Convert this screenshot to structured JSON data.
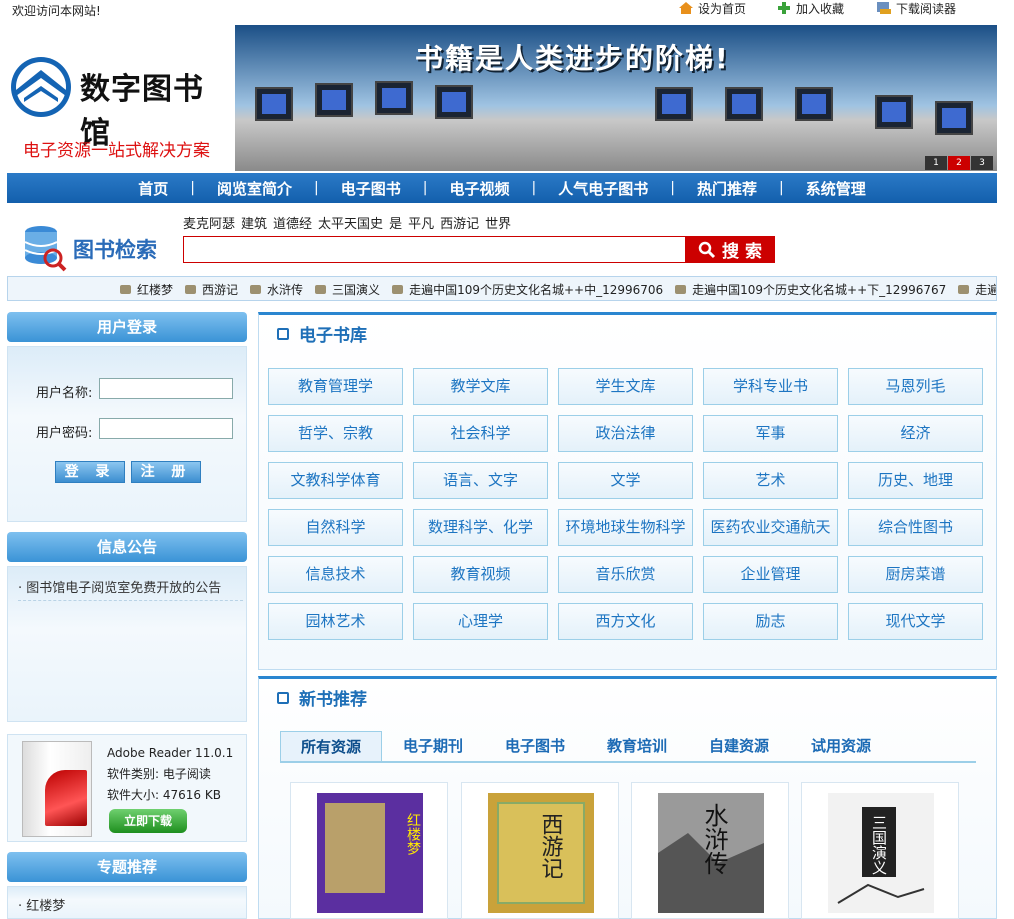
{
  "topbar": {
    "welcome": "欢迎访问本网站!",
    "links": [
      {
        "label": "设为首页",
        "icon": "home-icon"
      },
      {
        "label": "加入收藏",
        "icon": "plus-icon"
      },
      {
        "label": "下载阅读器",
        "icon": "download-icon"
      }
    ]
  },
  "logo": {
    "name": "数字图书馆",
    "slogan": "电子资源一站式解决方案"
  },
  "banner": {
    "slogan": "书籍是人类进步的阶梯!",
    "pages": [
      "1",
      "2",
      "3"
    ],
    "active_page": "2"
  },
  "nav": {
    "items": [
      "首页",
      "阅览室简介",
      "电子图书",
      "电子视频",
      "人气电子图书",
      "热门推荐",
      "系统管理"
    ]
  },
  "search": {
    "title": "图书检索",
    "hotwords": [
      "麦克阿瑟",
      "建筑",
      "道德经",
      "太平天国史",
      "是",
      "平凡",
      "西游记",
      "世界"
    ],
    "input_value": "",
    "button": "搜 索"
  },
  "marquee": {
    "items": [
      "红楼梦",
      "西游记",
      "水浒传",
      "三国演义",
      "走遍中国109个历史文化名城++中_12996706",
      "走遍中国109个历史文化名城++下_12996767",
      "走遍中"
    ]
  },
  "login": {
    "title": "用户登录",
    "username_label": "用户名称:",
    "password_label": "用户密码:",
    "login_button": "登 录",
    "register_button": "注 册"
  },
  "notice": {
    "title": "信息公告",
    "items": [
      "图书馆电子阅览室免费开放的公告"
    ]
  },
  "software": {
    "name": "Adobe Reader 11.0.1",
    "category": "软件类别: 电子阅读",
    "size": "软件大小: 47616 KB",
    "download": "立即下载"
  },
  "special": {
    "title": "专题推荐",
    "items": [
      "红楼梦"
    ]
  },
  "library": {
    "title": "电子书库",
    "categories": [
      "教育管理学",
      "教学文库",
      "学生文库",
      "学科专业书",
      "马恩列毛",
      "哲学、宗教",
      "社会科学",
      "政治法律",
      "军事",
      "经济",
      "文教科学体育",
      "语言、文字",
      "文学",
      "艺术",
      "历史、地理",
      "自然科学",
      "数理科学、化学",
      "环境地球生物科学",
      "医药农业交通航天",
      "综合性图书",
      "信息技术",
      "教育视频",
      "音乐欣赏",
      "企业管理",
      "厨房菜谱",
      "园林艺术",
      "心理学",
      "西方文化",
      "励志",
      "现代文学"
    ]
  },
  "newbooks": {
    "title": "新书推荐",
    "tabs": [
      "所有资源",
      "电子期刊",
      "电子图书",
      "教育培训",
      "自建资源",
      "试用资源"
    ],
    "active_tab": "所有资源",
    "books": [
      {
        "title": "红楼梦",
        "cover_color": "#5b2fa0"
      },
      {
        "title": "西游记",
        "cover_color": "#c9a23a"
      },
      {
        "title": "水浒传",
        "cover_color": "#9a9a9a"
      },
      {
        "title": "三国演义",
        "cover_color": "#f2f2f2"
      }
    ]
  }
}
